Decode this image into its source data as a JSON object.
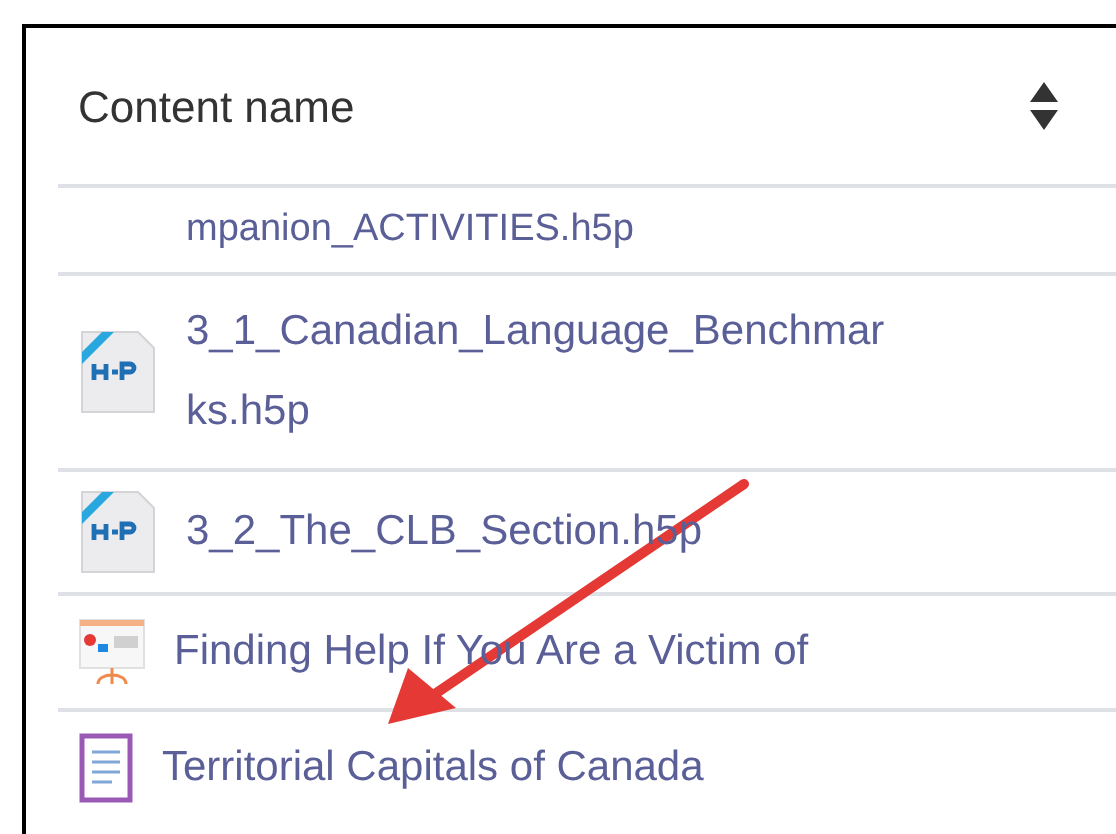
{
  "table": {
    "columns": [
      {
        "label": "Content name",
        "sortable": true
      }
    ],
    "rows": [
      {
        "kind": "none",
        "name": "mpanion_ACTIVITIES.h5p"
      },
      {
        "kind": "h5p",
        "name": "3_1_Canadian_Language_Benchmarks.h5p"
      },
      {
        "kind": "h5p",
        "name": "3_2_The_CLB_Section.h5p"
      },
      {
        "kind": "presentation",
        "name": "Finding Help If You Are a Victim of"
      },
      {
        "kind": "page",
        "name": "Territorial Capitals of Canada"
      }
    ]
  }
}
